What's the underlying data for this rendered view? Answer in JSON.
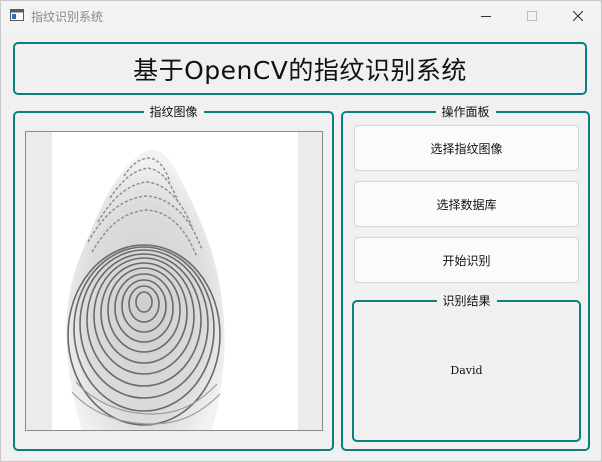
{
  "window": {
    "title": "指纹识别系统",
    "icons": {
      "app": "app-window-icon",
      "minimize": "minimize-icon",
      "maximize": "maximize-icon",
      "close": "close-icon"
    }
  },
  "header": {
    "title": "基于OpenCV的指纹识别系统"
  },
  "image_panel": {
    "legend": "指纹图像",
    "image": "fingerprint-image"
  },
  "ops_panel": {
    "legend": "操作面板",
    "buttons": {
      "select_image": "选择指纹图像",
      "select_db": "选择数据库",
      "start": "开始识别"
    },
    "result": {
      "legend": "识别结果",
      "value": "David"
    }
  },
  "colors": {
    "accent_border": "#0a8080",
    "background": "#f0f0f0"
  }
}
